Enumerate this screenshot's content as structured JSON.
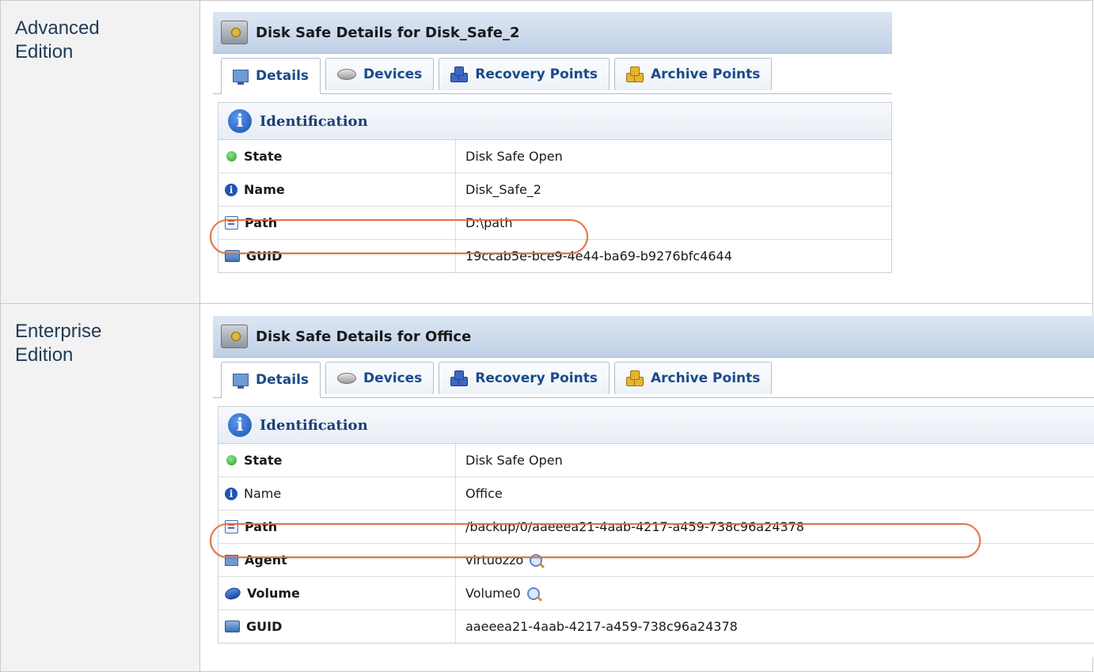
{
  "rows": [
    {
      "edition_label": [
        "Advanced",
        "Edition"
      ],
      "panel": {
        "title": "Disk Safe Details for Disk_Safe_2",
        "tabs": [
          "Details",
          "Devices",
          "Recovery Points",
          "Archive Points"
        ],
        "active_tab": "Details",
        "section_title": "Identification",
        "fields": [
          {
            "label": "State",
            "value": "Disk Safe Open",
            "icon": "green-status-icon"
          },
          {
            "label": "Name",
            "value": "Disk_Safe_2",
            "icon": "info-icon"
          },
          {
            "label": "Path",
            "value": "D:\\path",
            "icon": "path-icon",
            "highlighted": true
          },
          {
            "label": "GUID",
            "value": "19ccab5e-bce9-4e44-ba69-b9276bfc4644",
            "icon": "guid-icon"
          }
        ]
      }
    },
    {
      "edition_label": [
        "Enterprise",
        "Edition"
      ],
      "panel": {
        "title": "Disk Safe Details for Office",
        "tabs": [
          "Details",
          "Devices",
          "Recovery Points",
          "Archive Points"
        ],
        "active_tab": "Details",
        "section_title": "Identification",
        "fields": [
          {
            "label": "State",
            "value": "Disk Safe Open",
            "icon": "green-status-icon"
          },
          {
            "label": "Name",
            "value": "Office",
            "icon": "info-icon"
          },
          {
            "label": "Path",
            "value": "/backup/0/aaeeea21-4aab-4217-a459-738c96a24378",
            "icon": "path-icon",
            "highlighted": true
          },
          {
            "label": "Agent",
            "value": "virtuozzo",
            "icon": "agent-icon",
            "lookup": true
          },
          {
            "label": "Volume",
            "value": "Volume0",
            "icon": "volume-icon",
            "lookup": true
          },
          {
            "label": "GUID",
            "value": "aaeeea21-4aab-4217-a459-738c96a24378",
            "icon": "guid-icon"
          }
        ]
      }
    }
  ],
  "colors": {
    "highlight": "#e8703f",
    "header_gradient_top": "#dde7f3",
    "tab_text": "#1b4a8a",
    "edition_text": "#1f3b57"
  }
}
